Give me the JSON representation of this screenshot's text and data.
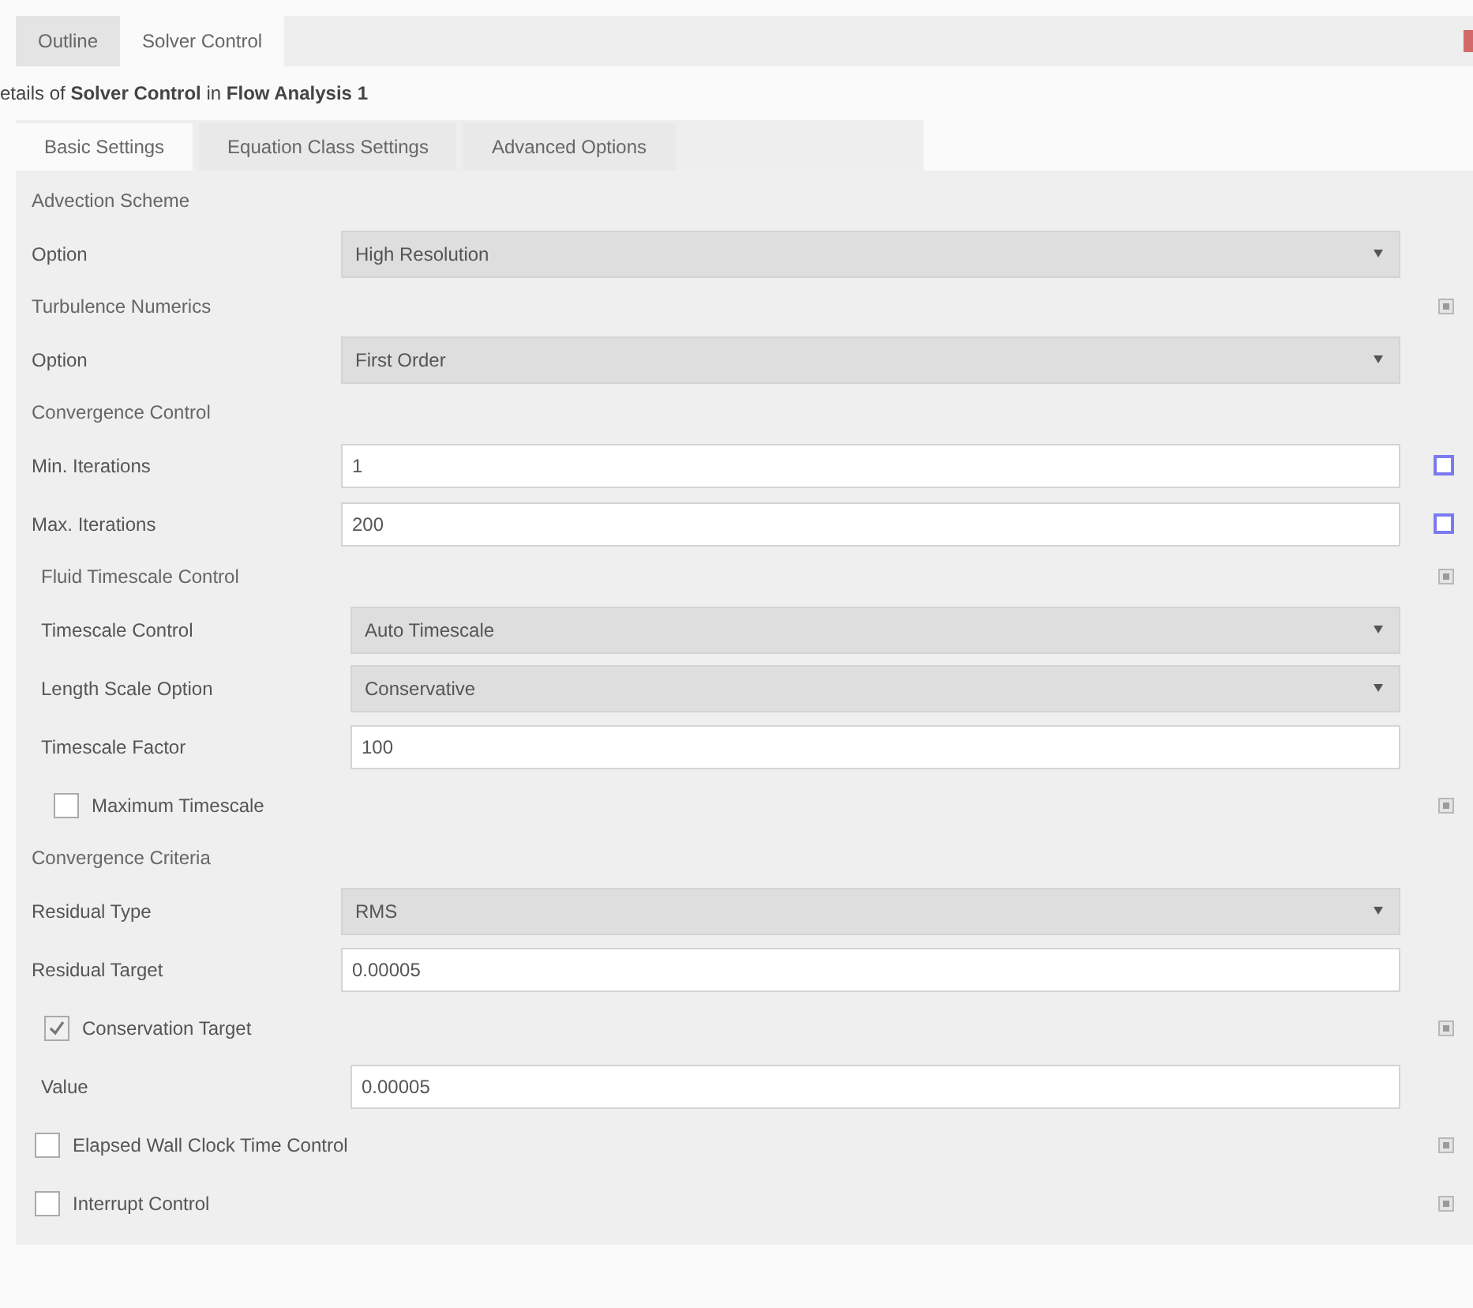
{
  "top_tabs": [
    {
      "label": "Outline",
      "selected": false
    },
    {
      "label": "Solver Control",
      "selected": true
    }
  ],
  "details": "etails of **Solver Control** in **Flow Analysis 1**",
  "tabs": [
    {
      "label": "Basic Settings",
      "selected": true
    },
    {
      "label": "Equation Class Settings",
      "selected": false
    },
    {
      "label": "Advanced Options",
      "selected": false
    }
  ],
  "items": [
    {
      "kind": "group",
      "title": "Advection Scheme",
      "optional": false,
      "children": [
        {
          "kind": "dropdown",
          "label": "Option",
          "value": "High Resolution"
        }
      ]
    },
    {
      "kind": "group",
      "title": "Turbulence Numerics",
      "optional": true,
      "children": [
        {
          "kind": "dropdown",
          "label": "Option",
          "value": "First Order"
        }
      ]
    },
    {
      "kind": "group",
      "title": "Convergence Control",
      "optional": false,
      "children": [
        {
          "kind": "field",
          "label": "Min. Iterations",
          "value": "1",
          "parameter": true
        },
        {
          "kind": "field",
          "label": "Max. Iterations",
          "value": "200",
          "parameter": true
        },
        {
          "kind": "group",
          "title": "Fluid Timescale Control",
          "optional": true,
          "children": [
            {
              "kind": "dropdown",
              "label": "Timescale Control",
              "value": "Auto Timescale"
            },
            {
              "kind": "dropdown",
              "label": "Length Scale Option",
              "value": "Conservative"
            },
            {
              "kind": "field",
              "label": "Timescale Factor",
              "value": "100",
              "parameter": false
            },
            {
              "kind": "check",
              "label": "Maximum Timescale",
              "checked": false,
              "optional": true
            }
          ]
        }
      ]
    },
    {
      "kind": "group",
      "title": "Convergence Criteria",
      "optional": false,
      "children": [
        {
          "kind": "dropdown",
          "label": "Residual Type",
          "value": "RMS"
        },
        {
          "kind": "field",
          "label": "Residual Target",
          "value": "0.00005",
          "parameter": false
        },
        {
          "kind": "check",
          "label": "Conservation Target",
          "checked": true,
          "optional": true,
          "children": [
            {
              "kind": "field",
              "label": "Value",
              "value": "0.00005",
              "parameter": false
            }
          ]
        }
      ]
    },
    {
      "kind": "check",
      "label": "Elapsed Wall Clock Time Control",
      "checked": false,
      "optional": true
    },
    {
      "kind": "check",
      "label": "Interrupt Control",
      "checked": false,
      "optional": true
    }
  ]
}
